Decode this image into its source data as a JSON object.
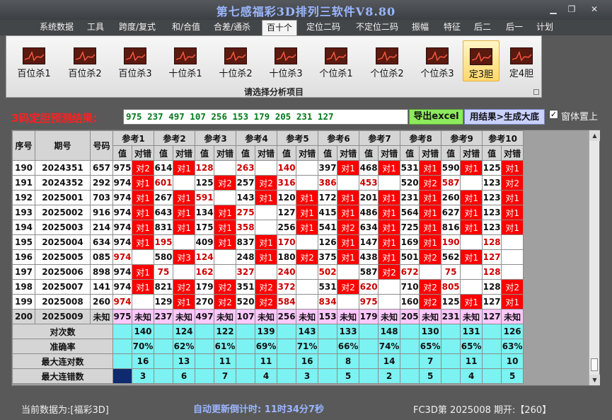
{
  "app": {
    "title": "第七感福彩3D排列三软件V8.80"
  },
  "window_controls": [
    "▁",
    "❐",
    "✕"
  ],
  "menu": [
    "系统数据",
    "工具",
    "跨度/复式",
    "和/合值",
    "合差/通杀",
    "百十个",
    "定位二码",
    "不定位二码",
    "振幅",
    "特征",
    "后二",
    "后一",
    "计划"
  ],
  "menu_active": "百十个",
  "ribbon": {
    "buttons": [
      "百位杀1",
      "百位杀2",
      "百位杀3",
      "十位杀1",
      "十位杀2",
      "十位杀3",
      "个位杀1",
      "个位杀2",
      "个位杀3",
      "定3胆",
      "定4胆"
    ],
    "active": "定3胆",
    "caption": "请选择分析项目"
  },
  "prediction": {
    "label": "3码定胆预测结果:",
    "result": "975 237 497 107 256 153 179 205 231 127",
    "export_button": "导出excel",
    "generate_button": "用结果>生成大底",
    "topmost_checked": "✓",
    "topmost_label": "窗体置上"
  },
  "table": {
    "headers": {
      "seq": "序号",
      "issue": "期号",
      "code": "号码",
      "value": "值",
      "hit": "对错"
    },
    "refs": [
      "参考1",
      "参考2",
      "参考3",
      "参考4",
      "参考5",
      "参考6",
      "参考7",
      "参考8",
      "参考9",
      "参考10"
    ],
    "rows": [
      {
        "seq": "190",
        "issue": "2024351",
        "code": "657",
        "cells": [
          [
            "975",
            "对2"
          ],
          [
            "614",
            "对1"
          ],
          [
            "128",
            ""
          ],
          [
            "263",
            ""
          ],
          [
            "140",
            ""
          ],
          [
            "397",
            "对1"
          ],
          [
            "468",
            "对1"
          ],
          [
            "531",
            "对1"
          ],
          [
            "590",
            "对1"
          ],
          [
            "125",
            "对1"
          ]
        ]
      },
      {
        "seq": "191",
        "issue": "2024352",
        "code": "292",
        "cells": [
          [
            "974",
            "对1"
          ],
          [
            "601",
            ""
          ],
          [
            "125",
            "对2"
          ],
          [
            "257",
            "对2"
          ],
          [
            "316",
            ""
          ],
          [
            "386",
            ""
          ],
          [
            "453",
            ""
          ],
          [
            "520",
            "对2"
          ],
          [
            "587",
            ""
          ],
          [
            "123",
            "对2"
          ]
        ]
      },
      {
        "seq": "192",
        "issue": "2025001",
        "code": "703",
        "cells": [
          [
            "974",
            "对1"
          ],
          [
            "267",
            "对1"
          ],
          [
            "591",
            ""
          ],
          [
            "143",
            "对1"
          ],
          [
            "120",
            "对1"
          ],
          [
            "172",
            "对1"
          ],
          [
            "201",
            "对1"
          ],
          [
            "231",
            "对1"
          ],
          [
            "260",
            "对1"
          ],
          [
            "123",
            "对1"
          ]
        ]
      },
      {
        "seq": "193",
        "issue": "2025002",
        "code": "916",
        "cells": [
          [
            "974",
            "对1"
          ],
          [
            "643",
            "对1"
          ],
          [
            "134",
            "对1"
          ],
          [
            "275",
            ""
          ],
          [
            "127",
            "对1"
          ],
          [
            "415",
            "对1"
          ],
          [
            "486",
            "对1"
          ],
          [
            "564",
            "对1"
          ],
          [
            "627",
            "对1"
          ],
          [
            "123",
            "对1"
          ]
        ]
      },
      {
        "seq": "194",
        "issue": "2025003",
        "code": "214",
        "cells": [
          [
            "974",
            "对1"
          ],
          [
            "831",
            "对1"
          ],
          [
            "175",
            "对1"
          ],
          [
            "358",
            ""
          ],
          [
            "256",
            "对1"
          ],
          [
            "541",
            "对2"
          ],
          [
            "634",
            "对1"
          ],
          [
            "725",
            "对1"
          ],
          [
            "816",
            "对1"
          ],
          [
            "123",
            "对1"
          ]
        ]
      },
      {
        "seq": "195",
        "issue": "2025004",
        "code": "634",
        "cells": [
          [
            "974",
            "对1"
          ],
          [
            "195",
            ""
          ],
          [
            "409",
            "对1"
          ],
          [
            "837",
            "对1"
          ],
          [
            "170",
            ""
          ],
          [
            "126",
            "对1"
          ],
          [
            "147",
            "对1"
          ],
          [
            "169",
            "对1"
          ],
          [
            "190",
            ""
          ],
          [
            "128",
            ""
          ]
        ]
      },
      {
        "seq": "196",
        "issue": "2025005",
        "code": "085",
        "cells": [
          [
            "974",
            ""
          ],
          [
            "580",
            "对3"
          ],
          [
            "124",
            ""
          ],
          [
            "248",
            "对1"
          ],
          [
            "180",
            "对2"
          ],
          [
            "375",
            "对1"
          ],
          [
            "438",
            "对1"
          ],
          [
            "501",
            "对2"
          ],
          [
            "562",
            "对1"
          ],
          [
            "127",
            ""
          ]
        ]
      },
      {
        "seq": "197",
        "issue": "2025006",
        "code": "898",
        "cells": [
          [
            "974",
            "对1"
          ],
          [
            "75",
            ""
          ],
          [
            "162",
            ""
          ],
          [
            "327",
            ""
          ],
          [
            "240",
            ""
          ],
          [
            "502",
            ""
          ],
          [
            "587",
            "对2"
          ],
          [
            "672",
            ""
          ],
          [
            "75",
            ""
          ],
          [
            "128",
            ""
          ]
        ]
      },
      {
        "seq": "198",
        "issue": "2025007",
        "code": "141",
        "cells": [
          [
            "974",
            "对1"
          ],
          [
            "821",
            "对2"
          ],
          [
            "179",
            "对2"
          ],
          [
            "351",
            "对2"
          ],
          [
            "372",
            ""
          ],
          [
            "531",
            "对2"
          ],
          [
            "620",
            ""
          ],
          [
            "710",
            "对2"
          ],
          [
            "805",
            ""
          ],
          [
            "128",
            "对2"
          ]
        ]
      },
      {
        "seq": "199",
        "issue": "2025008",
        "code": "260",
        "cells": [
          [
            "974",
            ""
          ],
          [
            "129",
            "对1"
          ],
          [
            "270",
            "对2"
          ],
          [
            "520",
            "对2"
          ],
          [
            "584",
            ""
          ],
          [
            "834",
            ""
          ],
          [
            "975",
            ""
          ],
          [
            "160",
            "对2"
          ],
          [
            "125",
            "对1"
          ],
          [
            "127",
            "对1"
          ]
        ]
      }
    ],
    "last_row": {
      "seq": "200",
      "issue": "2025009",
      "code": "未知",
      "values": [
        "975",
        "237",
        "497",
        "107",
        "256",
        "153",
        "179",
        "205",
        "231",
        "127"
      ],
      "unknown": "未知"
    },
    "stats": [
      {
        "label": "对次数",
        "values": [
          "140",
          "124",
          "122",
          "139",
          "143",
          "133",
          "148",
          "130",
          "131",
          "126"
        ]
      },
      {
        "label": "准确率",
        "values": [
          "70%",
          "62%",
          "61%",
          "69%",
          "71%",
          "66%",
          "74%",
          "65%",
          "65%",
          "63%"
        ]
      },
      {
        "label": "最大连对数",
        "values": [
          "16",
          "13",
          "11",
          "11",
          "16",
          "8",
          "14",
          "7",
          "11",
          "10"
        ]
      },
      {
        "label": "最大连错数",
        "values": [
          "3",
          "6",
          "7",
          "4",
          "3",
          "5",
          "2",
          "5",
          "4",
          "5"
        ]
      }
    ]
  },
  "status": {
    "current": "当前数据为:[福彩3D]",
    "countdown": "自动更新倒计时: 11时34分7秒",
    "issue": "FC3D第 2025008 期开:【260】"
  },
  "colors": {
    "hit_bg": "#ff0000",
    "miss_text": "#cc0000",
    "predict_row": "#ffc8ff",
    "stats_bg": "#7cf2f2",
    "accent_title": "#9ab6ff"
  }
}
